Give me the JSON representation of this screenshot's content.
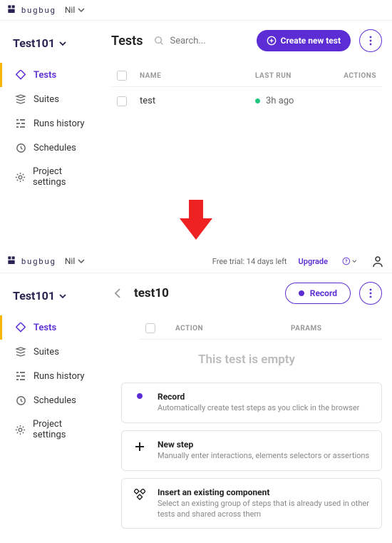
{
  "brand": "bugbug",
  "user": "Nil",
  "trial_text": "Free trial: 14 days left",
  "upgrade_label": "Upgrade",
  "project_name": "Test101",
  "nav": {
    "tests": "Tests",
    "suites": "Suites",
    "runs": "Runs history",
    "schedules": "Schedules",
    "settings": "Project settings"
  },
  "screen1": {
    "title": "Tests",
    "search_placeholder": "Search...",
    "create_btn": "Create new test",
    "columns": {
      "name": "NAME",
      "last": "LAST RUN",
      "actions": "ACTIONS"
    },
    "rows": [
      {
        "name": "test",
        "last": "3h ago"
      }
    ]
  },
  "screen2": {
    "test_name": "test10",
    "record_btn": "Record",
    "columns": {
      "action": "ACTION",
      "params": "PARAMS"
    },
    "empty_text": "This test is empty",
    "cards": {
      "record": {
        "title": "Record",
        "desc": "Automatically create test steps as you click in the browser"
      },
      "newstep": {
        "title": "New step",
        "desc": "Manually enter interactions, elements selectors or assertions"
      },
      "insert": {
        "title": "Insert an existing component",
        "desc": "Select an existing group of steps that is already used in other tests and shared across them"
      }
    }
  }
}
